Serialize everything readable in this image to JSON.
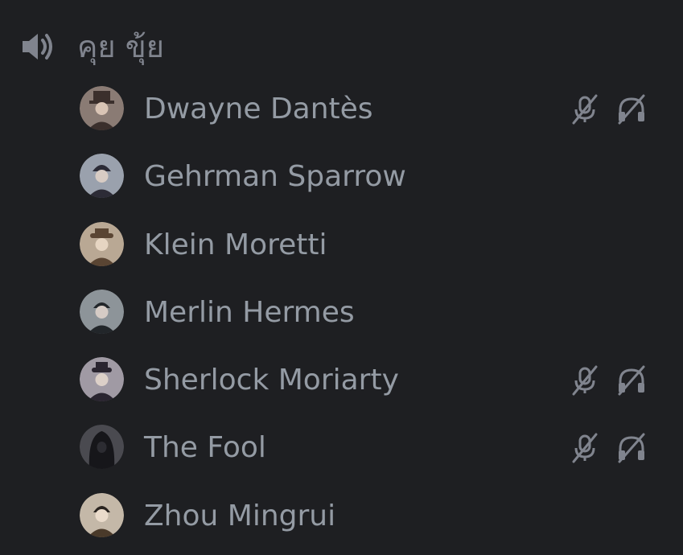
{
  "channel": {
    "name": "คุย ขุ้ย",
    "icon": "speaker-icon"
  },
  "colors": {
    "background": "#1e1f22",
    "text": "#949ba4",
    "icon": "#80848e"
  },
  "users": [
    {
      "name": "Dwayne Dantès",
      "muted": true,
      "deafened": true,
      "avatar_bg": "#8a7b74",
      "avatar_fg": "#3b2f2c"
    },
    {
      "name": "Gehrman Sparrow",
      "muted": false,
      "deafened": false,
      "avatar_bg": "#9aa1ad",
      "avatar_fg": "#2c2b36"
    },
    {
      "name": "Klein Moretti",
      "muted": false,
      "deafened": false,
      "avatar_bg": "#b9a894",
      "avatar_fg": "#5a4533"
    },
    {
      "name": "Merlin Hermes",
      "muted": false,
      "deafened": false,
      "avatar_bg": "#8d9499",
      "avatar_fg": "#22262a"
    },
    {
      "name": "Sherlock Moriarty",
      "muted": true,
      "deafened": true,
      "avatar_bg": "#a09aa4",
      "avatar_fg": "#2a2530"
    },
    {
      "name": "The Fool",
      "muted": true,
      "deafened": true,
      "avatar_bg": "#4a4a50",
      "avatar_fg": "#16161a"
    },
    {
      "name": "Zhou Mingrui",
      "muted": false,
      "deafened": false,
      "avatar_bg": "#c4b8a8",
      "avatar_fg": "#4a3a2a"
    }
  ]
}
